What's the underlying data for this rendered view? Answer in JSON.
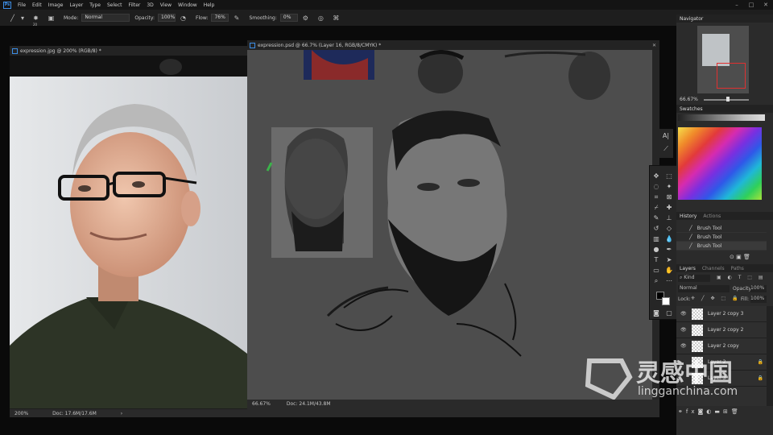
{
  "menubar": {
    "items": [
      "File",
      "Edit",
      "Image",
      "Layer",
      "Type",
      "Select",
      "Filter",
      "3D",
      "View",
      "Window",
      "Help"
    ]
  },
  "options": {
    "brush_size": "20",
    "mode_label": "Mode:",
    "mode_value": "Normal",
    "opacity_label": "Opacity:",
    "opacity_value": "100%",
    "flow_label": "Flow:",
    "flow_value": "76%",
    "smoothing_label": "Smoothing:",
    "smoothing_value": "0%"
  },
  "doc_left": {
    "tab": "expression.jpg @ 200% (RGB/8) *",
    "zoom": "200%",
    "doc": "Doc: 17.6M/17.6M"
  },
  "doc_main": {
    "tab": "expression.psd @ 66.7% (Layer 16, RGB/8/CMYK) *",
    "zoom": "66.67%",
    "doc": "Doc: 24.1M/43.8M"
  },
  "navigator": {
    "title": "Navigator",
    "zoom": "66.67%"
  },
  "swatches": {
    "title": "Swatches"
  },
  "history": {
    "tabs": [
      "History",
      "Actions"
    ],
    "items": [
      "Brush Tool",
      "Brush Tool",
      "Brush Tool"
    ]
  },
  "layers": {
    "tabs": [
      "Layers",
      "Channels",
      "Paths"
    ],
    "kind": "Kind",
    "blend": "Normal",
    "opacity_label": "Opacity:",
    "opacity": "100%",
    "lock_label": "Lock:",
    "fill_label": "Fill:",
    "fill": "100%",
    "items": [
      "Layer 2 copy 3",
      "Layer 2 copy 2",
      "Layer 2 copy",
      "Layer 2",
      "Layer 3"
    ]
  },
  "watermark": {
    "cn": "灵感中国",
    "url": "lingganchina.com"
  },
  "colors": {
    "accent": "#3d8ee6",
    "canvas": "#4d4d4d",
    "panel": "#2b2b2b"
  }
}
